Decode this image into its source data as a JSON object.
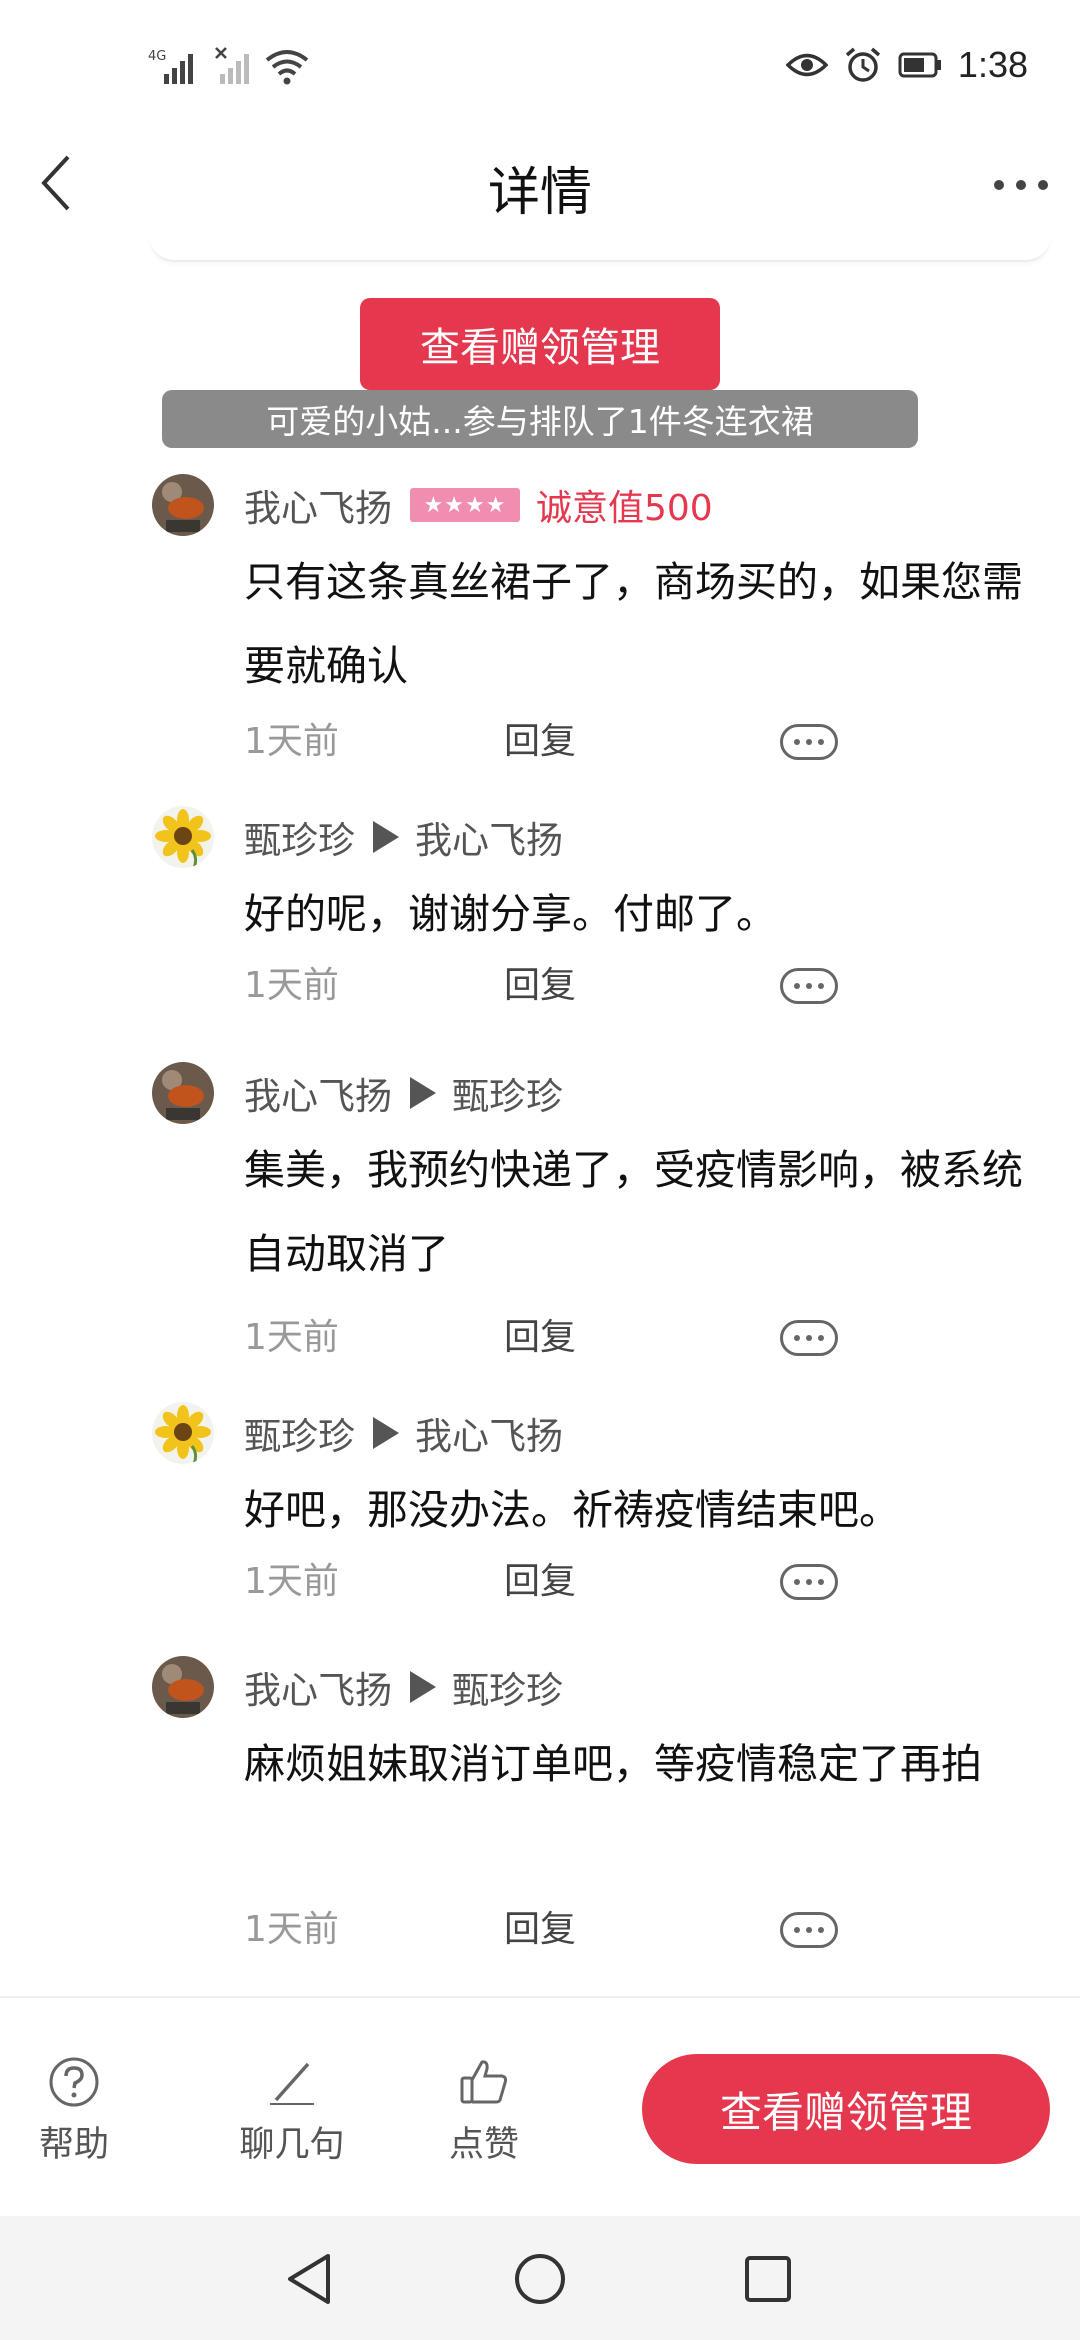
{
  "status_bar": {
    "network": "4G",
    "time": "1:38",
    "icons": [
      "signal-icon",
      "no-signal-icon",
      "wifi-icon",
      "eye-icon",
      "alarm-icon",
      "battery-icon"
    ]
  },
  "header": {
    "title": "详情"
  },
  "gift_manage_button": "查看赠领管理",
  "toast": "可爱的小姑...参与排队了1件冬连衣裙",
  "comments": [
    {
      "author": "我心飞扬",
      "badge": "★★★★",
      "sincerity": "诚意值500",
      "text": "只有这条真丝裙子了，商场买的，如果您需要就确认",
      "time": "1天前",
      "reply": "回复"
    },
    {
      "author": "甄珍珍",
      "reply_to": "我心飞扬",
      "text": "好的呢，谢谢分享。付邮了。",
      "time": "1天前",
      "reply": "回复"
    },
    {
      "author": "我心飞扬",
      "reply_to": "甄珍珍",
      "text": "集美，我预约快递了，受疫情影响，被系统自动取消了",
      "time": "1天前",
      "reply": "回复"
    },
    {
      "author": "甄珍珍",
      "reply_to": "我心飞扬",
      "text": "好吧，那没办法。祈祷疫情结束吧。",
      "time": "1天前",
      "reply": "回复"
    },
    {
      "author": "我心飞扬",
      "reply_to": "甄珍珍",
      "text": "麻烦姐妹取消订单吧，等疫情稳定了再拍",
      "time": "1天前",
      "reply": "回复"
    }
  ],
  "bottom_bar": {
    "help": "帮助",
    "chat": "聊几句",
    "like": "点赞",
    "cta": "查看赠领管理"
  },
  "colors": {
    "accent": "#e5384f",
    "toast_bg": "#8a8a8a",
    "badge": "#f08db1"
  }
}
